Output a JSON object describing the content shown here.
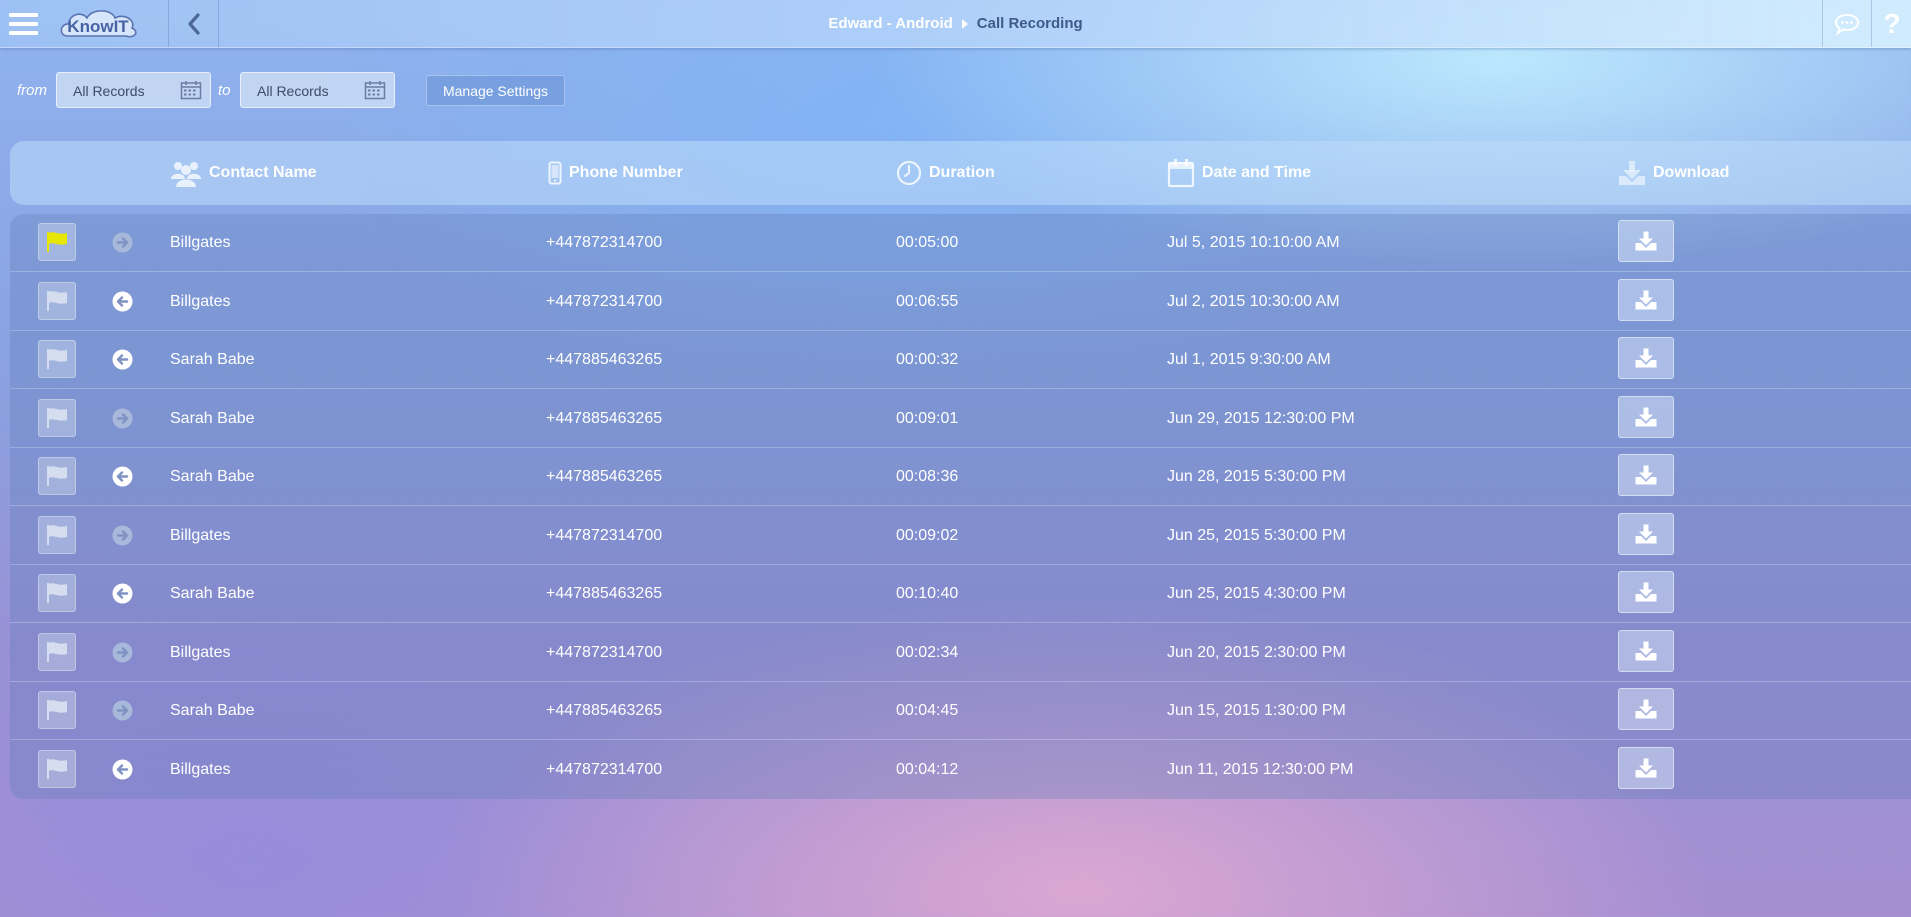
{
  "app": {
    "logo_text": "KnowIT"
  },
  "header": {
    "breadcrumb": [
      "Edward - Android",
      "Call Recording"
    ],
    "help_label": "?"
  },
  "filters": {
    "from_label": "from",
    "to_label": "to",
    "from_value": "All Records",
    "to_value": "All Records",
    "manage_label": "Manage Settings"
  },
  "table": {
    "columns": {
      "contact": "Contact Name",
      "phone": "Phone Number",
      "duration": "Duration",
      "datetime": "Date and Time",
      "download": "Download"
    },
    "rows": [
      {
        "flagged": true,
        "direction": "outgoing",
        "contact": "Billgates",
        "phone": "+447872314700",
        "duration": "00:05:00",
        "datetime": "Jul 5, 2015 10:10:00 AM"
      },
      {
        "flagged": false,
        "direction": "incoming",
        "contact": "Billgates",
        "phone": "+447872314700",
        "duration": "00:06:55",
        "datetime": "Jul 2, 2015 10:30:00 AM"
      },
      {
        "flagged": false,
        "direction": "incoming",
        "contact": "Sarah Babe",
        "phone": "+447885463265",
        "duration": "00:00:32",
        "datetime": "Jul 1, 2015 9:30:00 AM"
      },
      {
        "flagged": false,
        "direction": "outgoing",
        "contact": "Sarah Babe",
        "phone": "+447885463265",
        "duration": "00:09:01",
        "datetime": "Jun 29, 2015 12:30:00 PM"
      },
      {
        "flagged": false,
        "direction": "incoming",
        "contact": "Sarah Babe",
        "phone": "+447885463265",
        "duration": "00:08:36",
        "datetime": "Jun 28, 2015 5:30:00 PM"
      },
      {
        "flagged": false,
        "direction": "outgoing",
        "contact": "Billgates",
        "phone": "+447872314700",
        "duration": "00:09:02",
        "datetime": "Jun 25, 2015 5:30:00 PM"
      },
      {
        "flagged": false,
        "direction": "incoming",
        "contact": "Sarah Babe",
        "phone": "+447885463265",
        "duration": "00:10:40",
        "datetime": "Jun 25, 2015 4:30:00 PM"
      },
      {
        "flagged": false,
        "direction": "outgoing",
        "contact": "Billgates",
        "phone": "+447872314700",
        "duration": "00:02:34",
        "datetime": "Jun 20, 2015 2:30:00 PM"
      },
      {
        "flagged": false,
        "direction": "outgoing",
        "contact": "Sarah Babe",
        "phone": "+447885463265",
        "duration": "00:04:45",
        "datetime": "Jun 15, 2015 1:30:00 PM"
      },
      {
        "flagged": false,
        "direction": "incoming",
        "contact": "Billgates",
        "phone": "+447872314700",
        "duration": "00:04:12",
        "datetime": "Jun 11, 2015 12:30:00 PM"
      }
    ]
  },
  "icons": {
    "menu": "hamburger-menu-icon",
    "back": "chevron-left-icon",
    "chat": "chat-bubble-icon",
    "help": "question-mark-icon",
    "calendar": "calendar-icon",
    "contacts": "users-icon",
    "phone": "mobile-phone-icon",
    "duration": "clock-icon",
    "date": "calendar-icon",
    "download": "download-icon",
    "flag": "flag-icon",
    "incoming": "arrow-left-circle-icon",
    "outgoing": "arrow-right-circle-icon"
  },
  "colors": {
    "flag_active": "#e6e600",
    "flag_inactive": "#dfe6f2",
    "outgoing_icon": "#a7b8da",
    "incoming_icon": "#ffffff",
    "breadcrumb_current": "#3f5a8a"
  }
}
